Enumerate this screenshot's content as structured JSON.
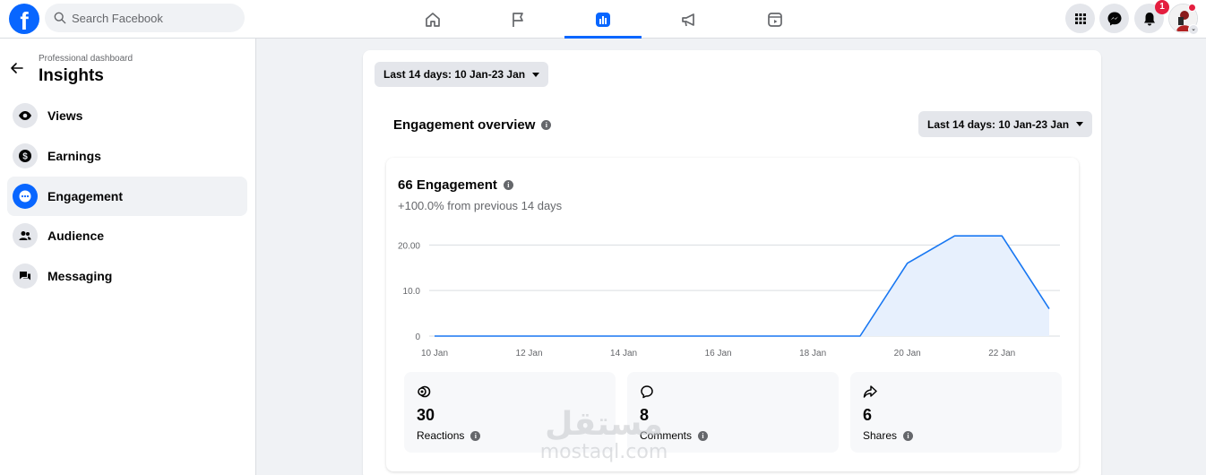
{
  "topbar": {
    "logo_letter": "f",
    "search_placeholder": "Search Facebook",
    "notification_count": "1"
  },
  "sidebar": {
    "breadcrumb": "Professional dashboard",
    "title": "Insights",
    "items": [
      {
        "label": "Views",
        "icon": "eye-icon"
      },
      {
        "label": "Earnings",
        "icon": "dollar-icon"
      },
      {
        "label": "Engagement",
        "icon": "chat-bubble-icon",
        "active": true
      },
      {
        "label": "Audience",
        "icon": "people-icon"
      },
      {
        "label": "Messaging",
        "icon": "messages-icon"
      }
    ]
  },
  "main": {
    "top_date_range": "Last 14 days: 10 Jan-23 Jan",
    "section_title": "Engagement overview",
    "section_date_range": "Last 14 days: 10 Jan-23 Jan",
    "engagement_title": "66 Engagement",
    "engagement_change": "+100.0% from previous 14 days",
    "stats": [
      {
        "value": "30",
        "label": "Reactions",
        "icon": "reaction-icon"
      },
      {
        "value": "8",
        "label": "Comments",
        "icon": "comment-icon"
      },
      {
        "value": "6",
        "label": "Shares",
        "icon": "share-icon"
      }
    ]
  },
  "chart_data": {
    "type": "area",
    "x": [
      "10 Jan",
      "11 Jan",
      "12 Jan",
      "13 Jan",
      "14 Jan",
      "15 Jan",
      "16 Jan",
      "17 Jan",
      "18 Jan",
      "19 Jan",
      "20 Jan",
      "21 Jan",
      "22 Jan",
      "23 Jan"
    ],
    "x_tick_labels": [
      "10 Jan",
      "12 Jan",
      "14 Jan",
      "16 Jan",
      "18 Jan",
      "20 Jan",
      "22 Jan"
    ],
    "y_tick_labels": [
      "0",
      "10.0",
      "20.00"
    ],
    "series": [
      {
        "values": [
          0,
          0,
          0,
          0,
          0,
          0,
          0,
          0,
          0,
          0,
          16,
          22,
          22,
          6
        ]
      }
    ],
    "ylim": [
      0,
      20
    ],
    "grid": true,
    "colors": {
      "line": "#1877f2",
      "fill": "#e7f0fd"
    }
  },
  "watermark": {
    "arabic": "مستقل",
    "latin": "mostaql.com"
  }
}
